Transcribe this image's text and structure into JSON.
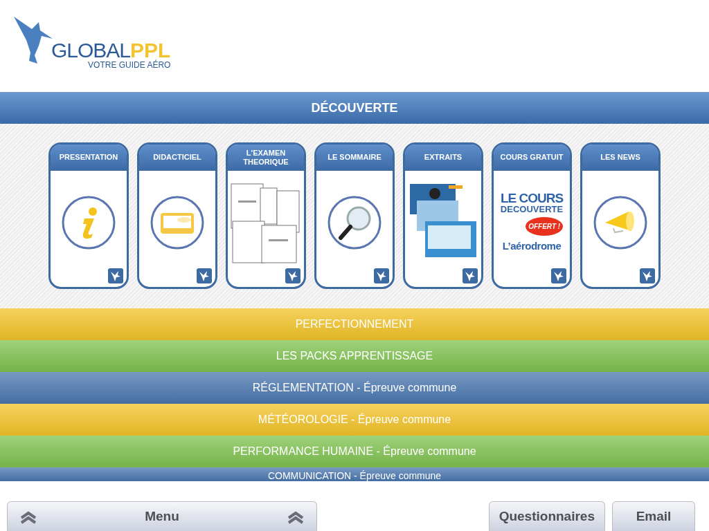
{
  "logo": {
    "brand_a": "GLOBAL",
    "brand_b": "PPL",
    "tagline": "VOTRE GUIDE AÉRO"
  },
  "section": {
    "title": "DÉCOUVERTE"
  },
  "cards": [
    {
      "title": "PRESENTATION",
      "kind": "info"
    },
    {
      "title": "DIDACTICIEL",
      "kind": "tablet"
    },
    {
      "title": "L'EXAMEN THEORIQUE",
      "kind": "documents"
    },
    {
      "title": "LE SOMMAIRE",
      "kind": "magnifier"
    },
    {
      "title": "EXTRAITS",
      "kind": "slides"
    },
    {
      "title": "COURS GRATUIT",
      "kind": "promo",
      "promo": {
        "line1": "LE COURS",
        "line2": "DECOUVERTE",
        "badge": "OFFERT !",
        "line3": "L’aérodrome"
      }
    },
    {
      "title": "LES NEWS",
      "kind": "megaphone"
    }
  ],
  "categories": [
    {
      "label": "PERFECTIONNEMENT",
      "color": "#f3c327"
    },
    {
      "label": "LES PACKS APPRENTISSAGE",
      "color": "#7fc24f"
    },
    {
      "label": "RÉGLEMENTATION - Épreuve commune",
      "color": "#4a77b0"
    },
    {
      "label": "MÉTÉOROLOGIE - Épreuve commune",
      "color": "#f3c327"
    },
    {
      "label": "PERFORMANCE HUMAINE - Épreuve commune",
      "color": "#7fc24f"
    },
    {
      "label": "COMMUNICATION - Épreuve commune",
      "color": "#4a77b0"
    }
  ],
  "toolbar": {
    "menu": "Menu",
    "buttons": [
      "Questionnaires",
      "Email"
    ]
  }
}
